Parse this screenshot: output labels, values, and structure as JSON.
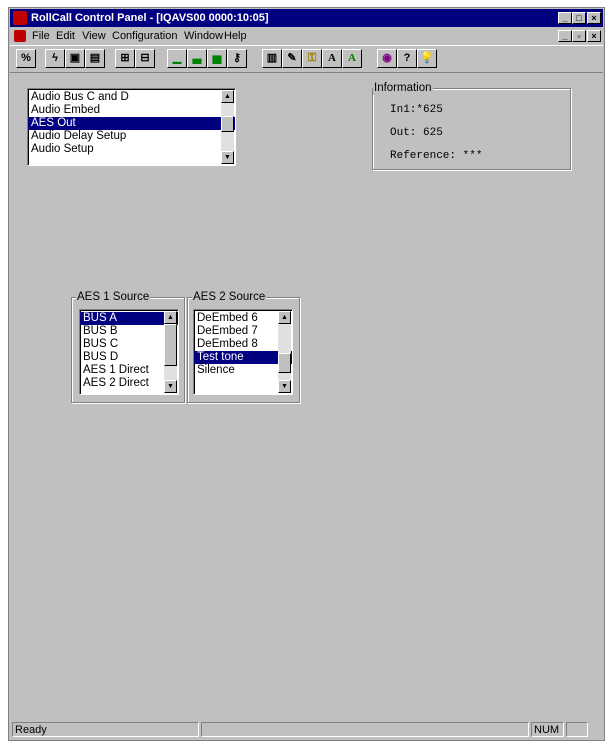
{
  "window": {
    "title": "RollCall Control Panel - [IQAVS00 0000:10:05]"
  },
  "menu": [
    "File",
    "Edit",
    "View",
    "Configuration",
    "Window",
    "Help"
  ],
  "toolbar": {
    "icons": [
      "connect-icon",
      "lightning-icon",
      "save-icon",
      "save-all-icon",
      "network-down-icon",
      "network-up-icon",
      "bar-low-icon",
      "bar-mid-icon",
      "bar-high-icon",
      "key-icon",
      "book-icon",
      "edit-icon",
      "lock-icon",
      "font-a-icon",
      "font-a-green-icon",
      "eye-icon",
      "help-icon",
      "tips-icon"
    ],
    "letter_a": "A"
  },
  "menu_list": {
    "items": [
      "Audio Bus C and D",
      "Audio Embed",
      "AES Out",
      "Audio Delay Setup",
      "Audio Setup"
    ],
    "selected": 2
  },
  "information": {
    "label": "Information",
    "in1": "In1:*625",
    "out": "Out: 625",
    "reference": "Reference: ***"
  },
  "aes1": {
    "label": "AES 1 Source",
    "items": [
      "BUS A",
      "BUS B",
      "BUS C",
      "BUS D",
      "AES 1 Direct",
      "AES 2 Direct"
    ],
    "selected": 0
  },
  "aes2": {
    "label": "AES 2 Source",
    "items": [
      "DeEmbed 6",
      "DeEmbed 7",
      "DeEmbed 8",
      "Test tone",
      "Silence"
    ],
    "selected": 3
  },
  "status": {
    "text": "Ready",
    "num": "NUM"
  },
  "colors": {
    "titlebar": "#000080",
    "selection": "#000080",
    "face": "#c0c0c0"
  }
}
